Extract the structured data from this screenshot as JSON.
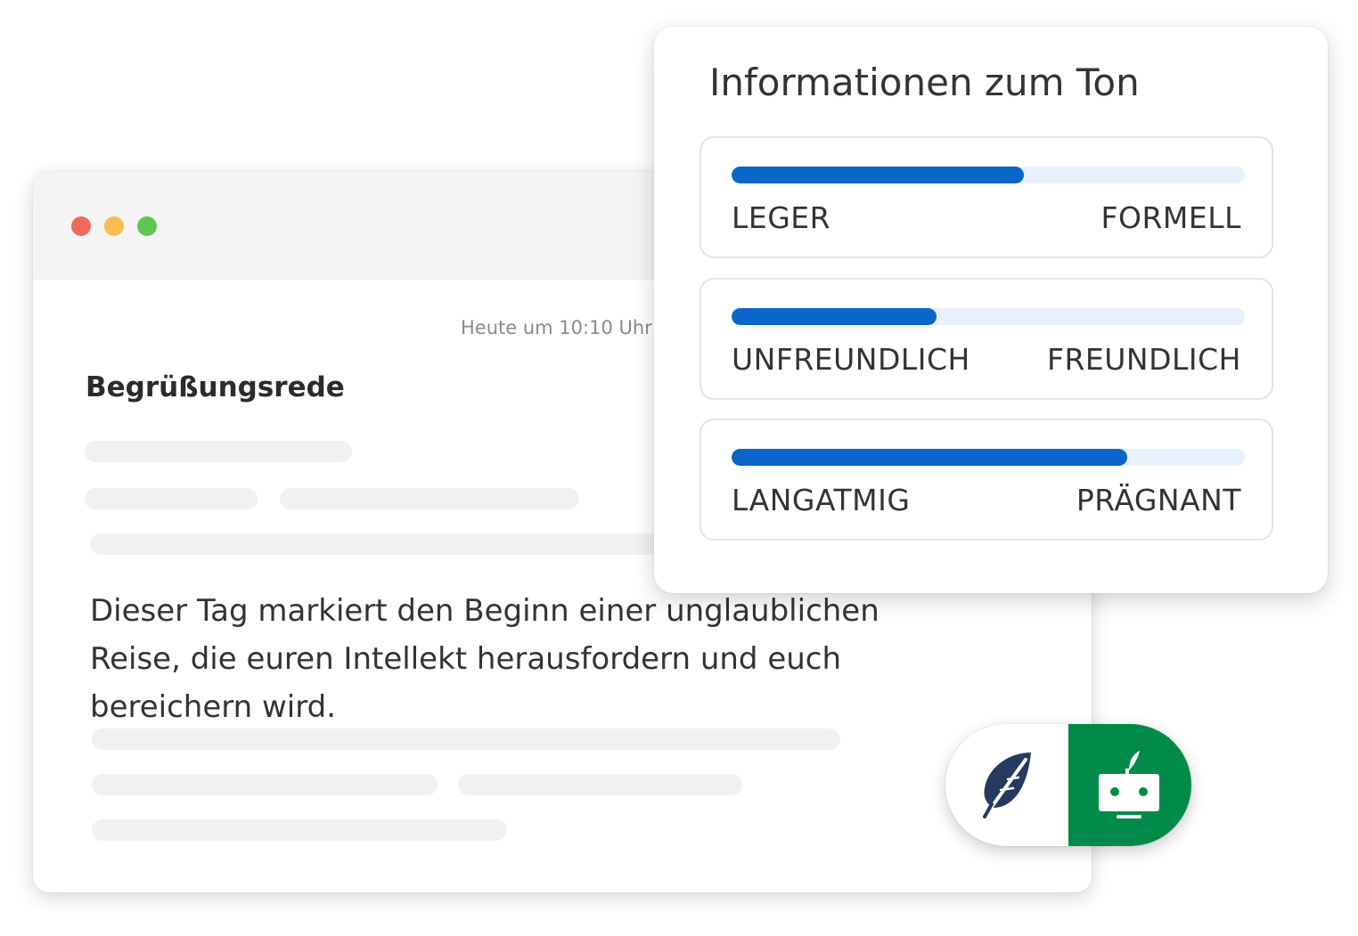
{
  "document": {
    "timestamp": "Heute um 10:10 Uhr",
    "title": "Begrüßungsrede",
    "body": "Dieser Tag markiert den Beginn einer unglaublichen Reise, die euren Intellekt herausfordern und euch bereichern wird."
  },
  "window_controls": {
    "close_color": "#ec6a5e",
    "minimize_color": "#f4bf4f",
    "maximize_color": "#61c554"
  },
  "tone": {
    "title": "Informationen zum Ton",
    "scales": [
      {
        "left": "LEGER",
        "right": "FORMELL",
        "level": 0.57
      },
      {
        "left": "UNFREUNDLICH",
        "right": "FREUNDLICH",
        "level": 0.4
      },
      {
        "left": "LANGATMIG",
        "right": "PRÄGNANT",
        "level": 0.77
      }
    ],
    "fill_color": "#0a66c8",
    "track_color": "#e8f1fb"
  },
  "toggle": {
    "options": [
      {
        "icon": "feather-icon",
        "active": false
      },
      {
        "icon": "robot-icon",
        "active": true
      }
    ],
    "active_color": "#008a4a"
  }
}
